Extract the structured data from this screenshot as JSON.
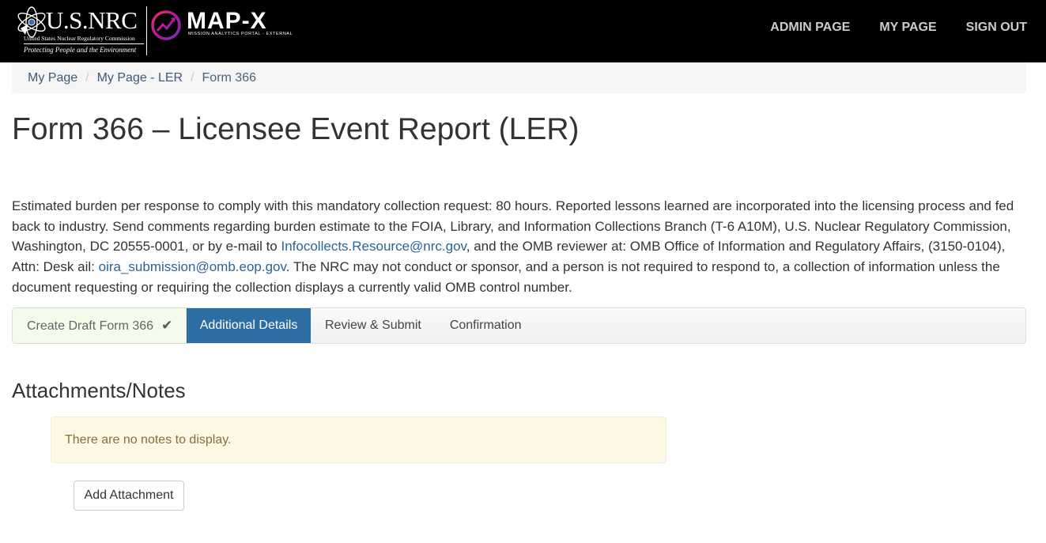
{
  "header": {
    "nrc_logo": {
      "wordmark": "U.S.NRC",
      "subtitle": "United States Nuclear Regulatory Commission",
      "tagline": "Protecting People and the Environment",
      "icon": "atom-emblem-icon"
    },
    "app_logo": {
      "wordmark": "MAP-X",
      "subtitle": "MISSION ANALYTICS PORTAL - EXTERNAL",
      "icon": "mapx-chart-circle-icon",
      "accent_colors": [
        "#e8305a",
        "#b5179e",
        "#7b2cbf"
      ]
    },
    "nav": [
      {
        "label": "ADMIN PAGE"
      },
      {
        "label": "MY PAGE"
      },
      {
        "label": "SIGN OUT"
      }
    ]
  },
  "breadcrumb": {
    "items": [
      {
        "label": "My Page"
      },
      {
        "label": "My Page - LER"
      }
    ],
    "current": "Form 366"
  },
  "page": {
    "title": "Form 366 – Licensee Event Report (LER)"
  },
  "notice": {
    "part1": "Estimated burden per response to comply with this mandatory collection request: 80 hours. Reported lessons learned are incorporated into the licensing process and fed back to industry. Send comments regarding burden estimate to the FOIA, Library, and Information Collections Branch (T-6 A10M), U.S. Nuclear Regulatory Commission, Washington, DC 20555-0001, or by e-mail to ",
    "email1": "Infocollects.Resource@nrc.gov",
    "part2": ", and the OMB reviewer at: OMB Office of Information and Regulatory Affairs, (3150-0104), Attn: Desk ail: ",
    "email2": "oira_submission@omb.eop.gov",
    "part3": ". The NRC may not conduct or sponsor, and a person is not required to respond to, a collection of information unless the document requesting or requiring the collection displays a currently valid OMB control number."
  },
  "wizard": {
    "steps": [
      {
        "label": "Create Draft Form 366",
        "state": "completed",
        "icon": "checkmark-icon"
      },
      {
        "label": "Additional Details",
        "state": "active"
      },
      {
        "label": "Review & Submit",
        "state": "pending"
      },
      {
        "label": "Confirmation",
        "state": "pending"
      }
    ],
    "active_color": "#2e6da4",
    "completed_color": "#f4fbea"
  },
  "attachments": {
    "heading": "Attachments/Notes",
    "empty_message": "There are no notes to display.",
    "add_button_label": "Add Attachment"
  }
}
